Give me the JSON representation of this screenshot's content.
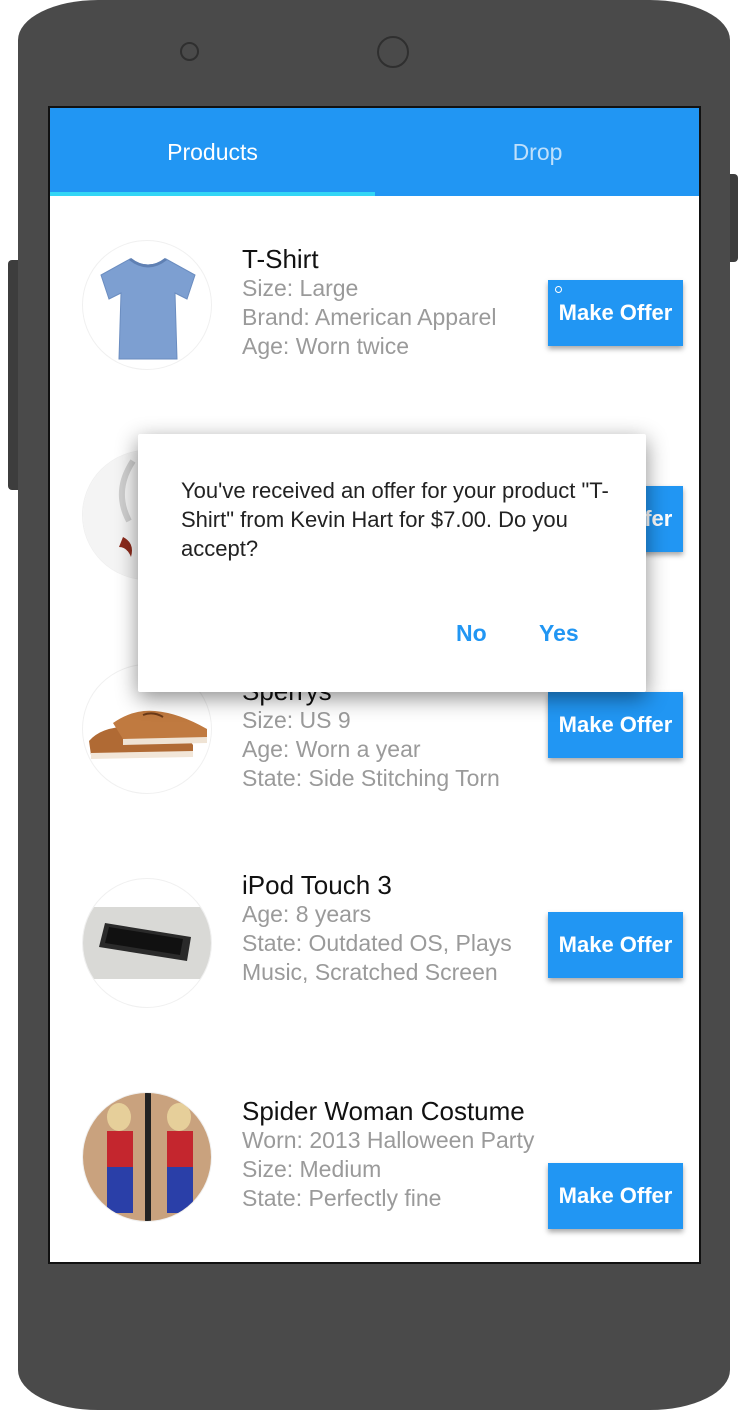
{
  "tabs": [
    {
      "label": "Products",
      "active": true
    },
    {
      "label": "Drop",
      "active": false
    }
  ],
  "colors": {
    "primary": "#2196f3",
    "tab_indicator": "#33d6f5",
    "detail_text": "#9a9a9a"
  },
  "products": [
    {
      "title": "T-Shirt",
      "details": [
        "Size: Large",
        "Brand: American Apparel",
        "Age: Worn twice"
      ],
      "button": "Make Offer",
      "image": "blue-tshirt"
    },
    {
      "title": "",
      "details": [],
      "button": "Make Offer",
      "image": "white-item"
    },
    {
      "title": "Sperrys",
      "details": [
        "Size: US 9",
        "Age: Worn a year",
        "State: Side Stitching Torn"
      ],
      "button": "Make Offer",
      "image": "boat-shoes"
    },
    {
      "title": "iPod Touch 3",
      "details": [
        "Age: 8 years",
        "State: Outdated OS, Plays Music, Scratched Screen"
      ],
      "button": "Make Offer",
      "image": "ipod"
    },
    {
      "title": "Spider Woman Costume",
      "details": [
        "Worn: 2013 Halloween Party",
        "Size: Medium",
        "State: Perfectly fine"
      ],
      "button": "Make Offer",
      "image": "costume-photo"
    }
  ],
  "dialog": {
    "message": "You've received an offer for your product \"T-Shirt\" from Kevin Hart for $7.00. Do you accept?",
    "no_label": "No",
    "yes_label": "Yes"
  }
}
